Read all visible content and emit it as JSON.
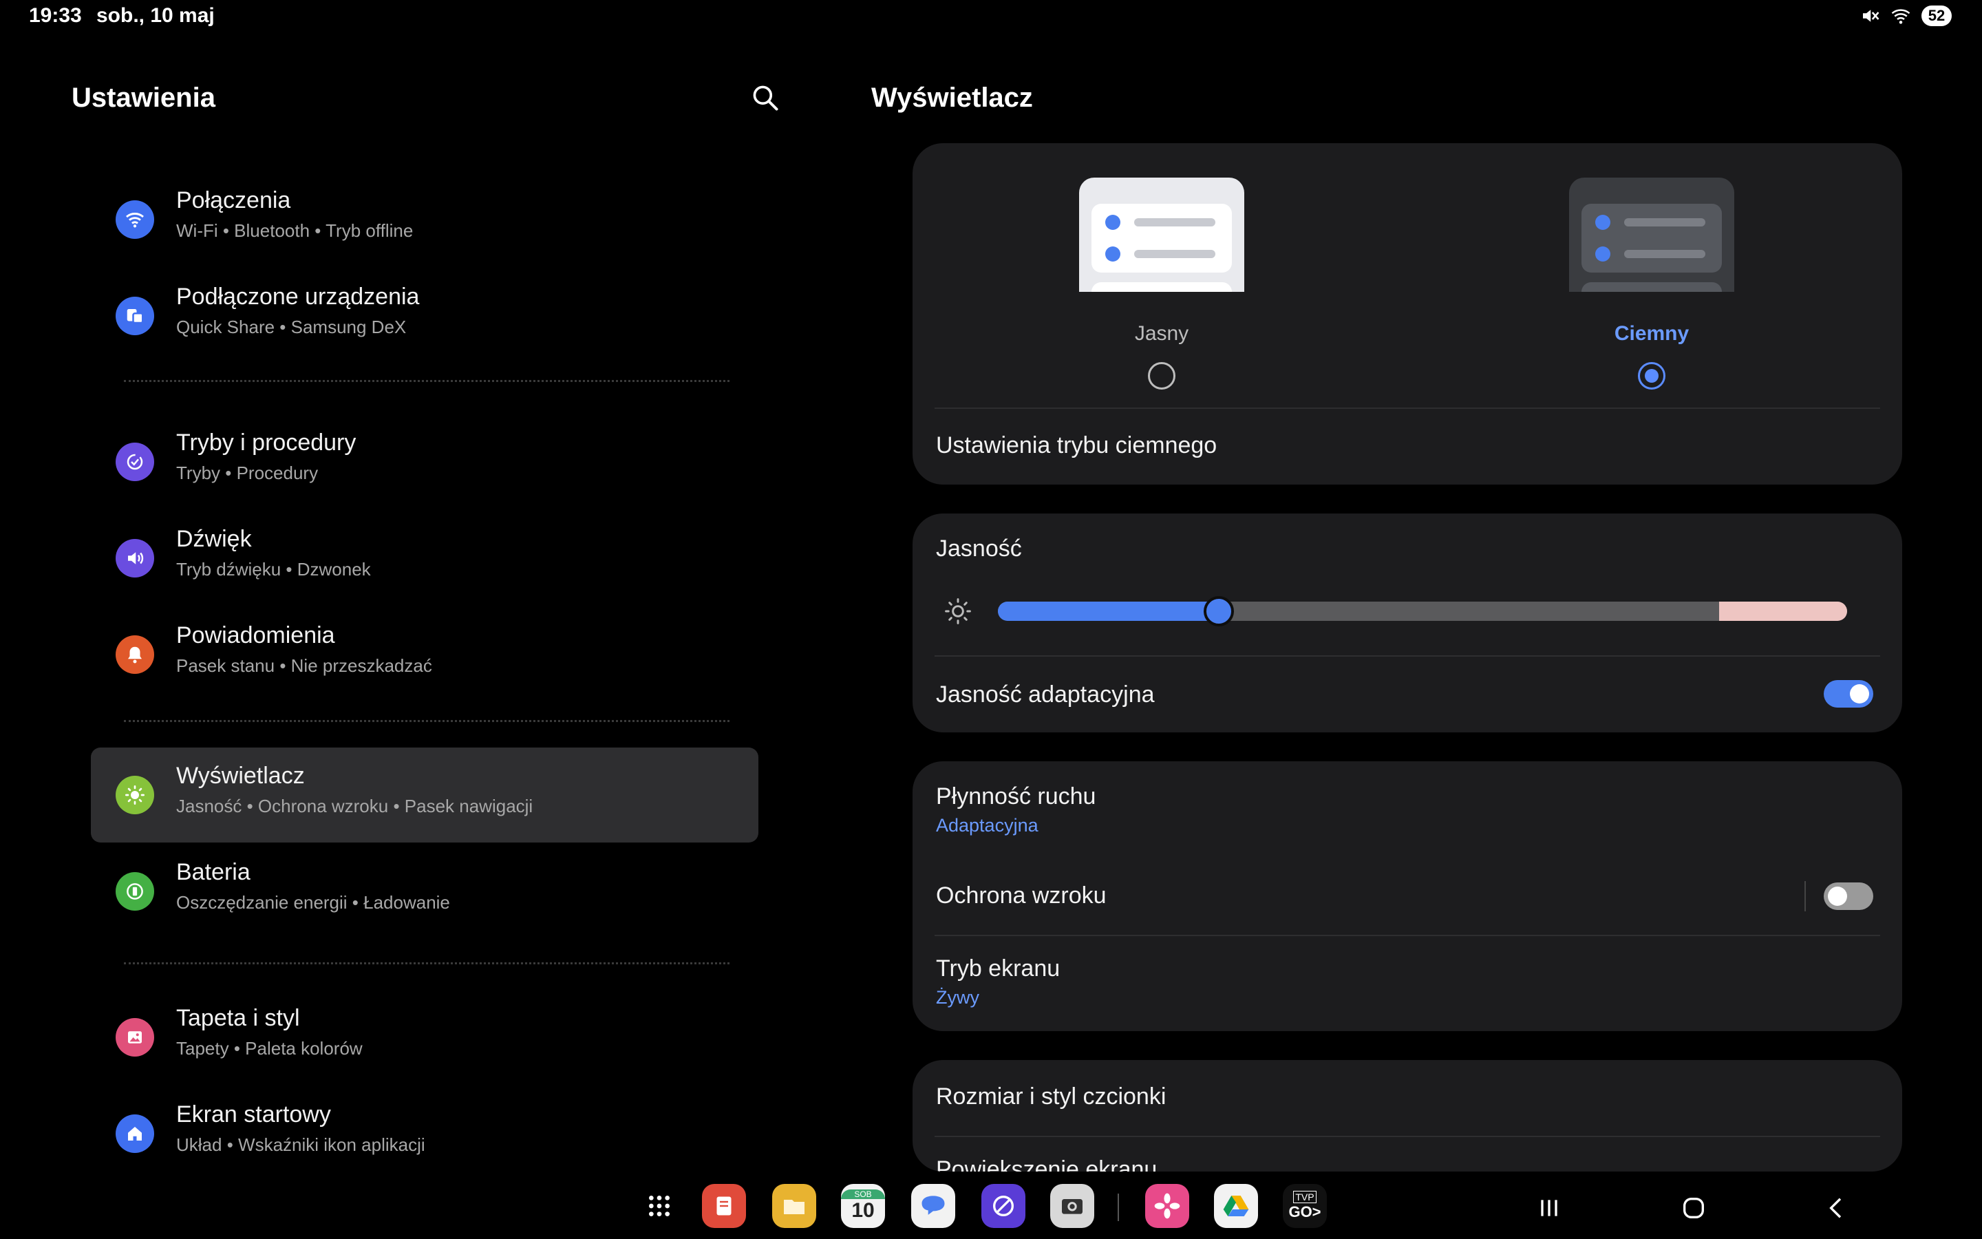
{
  "status_bar": {
    "time": "19:33",
    "date": "sob., 10 maj",
    "battery": "52",
    "icons": [
      "mute-icon",
      "wifi-icon",
      "battery-icon"
    ]
  },
  "left_panel": {
    "title": "Ustawienia",
    "search_icon": "search-icon",
    "items": [
      {
        "title": "Połączenia",
        "subtitle": "Wi-Fi  •  Bluetooth  •  Tryb offline",
        "icon": "wifi-icon",
        "color": "#3f6ff0"
      },
      {
        "title": "Podłączone urządzenia",
        "subtitle": "Quick Share  •  Samsung DeX",
        "icon": "devices-icon",
        "color": "#3f6ff0"
      },
      {
        "title": "Tryby i procedury",
        "subtitle": "Tryby  •  Procedury",
        "icon": "modes-icon",
        "color": "#6a4de0"
      },
      {
        "title": "Dźwięk",
        "subtitle": "Tryb dźwięku  •  Dzwonek",
        "icon": "sound-icon",
        "color": "#6a4de0"
      },
      {
        "title": "Powiadomienia",
        "subtitle": "Pasek stanu  •  Nie przeszkadzać",
        "icon": "bell-icon",
        "color": "#e0582a"
      },
      {
        "title": "Wyświetlacz",
        "subtitle": "Jasność  •  Ochrona wzroku  •  Pasek nawigacji",
        "icon": "sun-icon",
        "color": "#86c23a"
      },
      {
        "title": "Bateria",
        "subtitle": "Oszczędzanie energii  •  Ładowanie",
        "icon": "battery-icon",
        "color": "#44b044"
      },
      {
        "title": "Tapeta i styl",
        "subtitle": "Tapety  •  Paleta kolorów",
        "icon": "wallpaper-icon",
        "color": "#e0507a"
      },
      {
        "title": "Ekran startowy",
        "subtitle": "Układ  •  Wskaźniki ikon aplikacji",
        "icon": "home-icon",
        "color": "#3f6ff0"
      }
    ],
    "selected_index": 5
  },
  "right_panel": {
    "title": "Wyświetlacz",
    "theme": {
      "light_label": "Jasny",
      "dark_label": "Ciemny",
      "selected": "dark",
      "dark_mode_settings": "Ustawienia trybu ciemnego"
    },
    "brightness": {
      "label": "Jasność",
      "level": 0.26,
      "adaptive_label": "Jasność adaptacyjna",
      "adaptive_on": true
    },
    "motion": {
      "label": "Płynność ruchu",
      "value": "Adaptacyjna",
      "eye_comfort_label": "Ochrona wzroku",
      "eye_comfort_on": false,
      "screen_mode_label": "Tryb ekranu",
      "screen_mode_value": "Żywy"
    },
    "font": {
      "label": "Rozmiar i styl czcionki",
      "partial_label": "Powiększenie ekranu"
    }
  },
  "taskbar": {
    "apps": [
      "apps-grid-icon",
      "notes-icon",
      "files-icon",
      "calendar-icon",
      "messages-icon",
      "internet-icon",
      "camera-icon",
      "gallery-icon",
      "drive-icon",
      "tvp-go-icon"
    ],
    "calendar_day_label": "SOB",
    "calendar_day": "10",
    "tvp_label": "TVP",
    "tvp_go": "GO>",
    "nav": [
      "recents-button",
      "home-button",
      "back-button"
    ]
  }
}
